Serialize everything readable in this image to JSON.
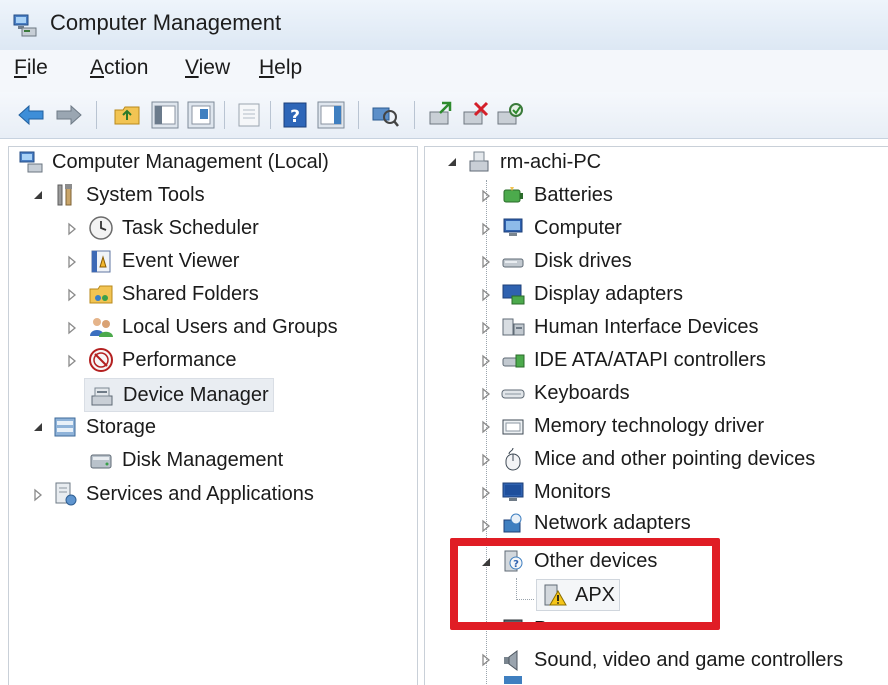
{
  "window": {
    "title": "Computer Management"
  },
  "menu": {
    "file": {
      "hot": "F",
      "rest": "ile"
    },
    "action": {
      "hot": "A",
      "rest": "ction"
    },
    "view": {
      "hot": "V",
      "rest": "iew"
    },
    "help": {
      "hot": "H",
      "rest": "elp"
    }
  },
  "left_tree": {
    "root": "Computer Management (Local)",
    "system_tools": "System Tools",
    "task_scheduler": "Task Scheduler",
    "event_viewer": "Event Viewer",
    "shared_folders": "Shared Folders",
    "local_users": "Local Users and Groups",
    "performance": "Performance",
    "device_manager": "Device Manager",
    "storage": "Storage",
    "disk_management": "Disk Management",
    "services": "Services and Applications"
  },
  "right_tree": {
    "root": "rm-achi-PC",
    "items": [
      "Batteries",
      "Computer",
      "Disk drives",
      "Display adapters",
      "Human Interface Devices",
      "IDE ATA/ATAPI controllers",
      "Keyboards",
      "Memory technology driver",
      "Mice and other pointing devices",
      "Monitors",
      "Network adapters"
    ],
    "other_devices": "Other devices",
    "apx": "APX",
    "processors": "Processors",
    "sound": "Sound, video and game controllers"
  },
  "colors": {
    "highlight": "#e01d25",
    "selection": "#e9edf2"
  }
}
